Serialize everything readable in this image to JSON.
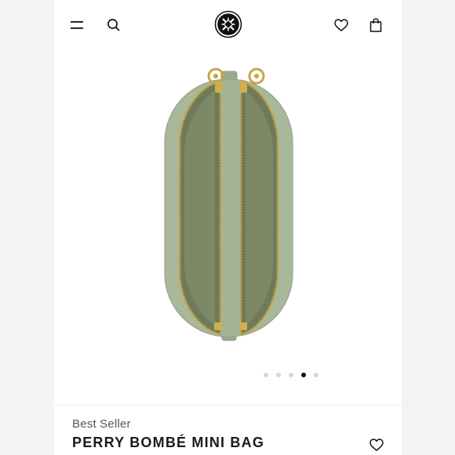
{
  "header": {
    "menu_icon": "hamburger-menu-icon",
    "search_icon": "search-icon",
    "logo_icon": "double-t-logo-icon",
    "wishlist_icon": "heart-outline-icon",
    "bag_icon": "shopping-bag-icon"
  },
  "gallery": {
    "slide_count": 5,
    "active_slide": 4
  },
  "product": {
    "badge": "Best Seller",
    "name": "PERRY BOMBÉ MINI BAG",
    "wishlist_icon": "heart-outline-icon"
  },
  "colors": {
    "bag_green": "#a9b79a",
    "bag_interior": "#6f7a59",
    "zipper_gold": "#c9a445",
    "text_dark": "#1a1a1a"
  }
}
